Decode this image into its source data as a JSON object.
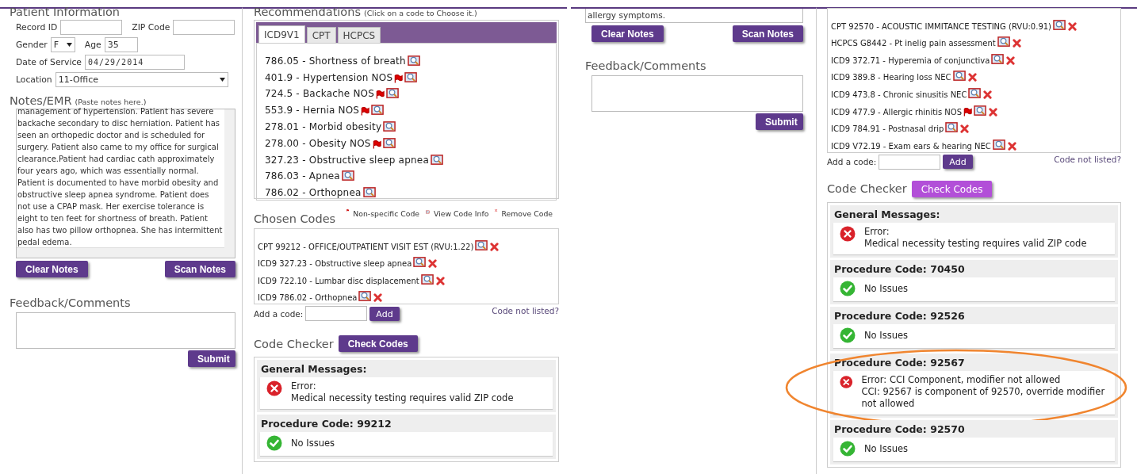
{
  "patient_form": {
    "title": "Patient Information",
    "rows": [
      [
        {
          "label": "Record ID",
          "kind": "text"
        },
        {
          "label": "ZIP Code",
          "kind": "text"
        }
      ],
      [
        {
          "label": "Gender",
          "kind": "select",
          "value": "F"
        },
        {
          "label": "Age",
          "kind": "text",
          "value": "35"
        }
      ],
      [
        {
          "label": "Date of Service",
          "kind": "date",
          "value": "04/29/2014"
        }
      ],
      [
        {
          "label": "Location",
          "kind": "select",
          "value": "11-Office"
        }
      ]
    ]
  },
  "notes": {
    "title": "Notes/EMR",
    "hint": "(Paste notes here.)",
    "text": "management of hypertension. Patient has severe backache secondary to disc herniation. Patient has seen an orthopedic doctor and is scheduled for surgery. Patient also came to my office for surgical clearance.Patient had cardiac cath approximately four years ago, which was essentially normal. Patient is documented to have morbid obesity and obstructive sleep apnea syndrome. Patient does not use a CPAP mask. Her exercise tolerance is eight to ten feet for shortness of breath. Patient also has two pillow orthopnea. She has intermittent pedal edema.",
    "buttons": [
      "Clear Notes",
      "Scan Notes"
    ]
  },
  "feedback": {
    "title": "Feedback/Comments",
    "button": "Submit"
  },
  "recommendations": {
    "title": "Recommendations",
    "hint": "(Click on a code to Choose it.)",
    "tabs": [
      {
        "label": "ICD9V1",
        "selected": true
      },
      {
        "label": "CPT",
        "selected": false
      },
      {
        "label": "HCPCS",
        "selected": false
      }
    ],
    "items": [
      {
        "text": "786.05 - Shortness of breath",
        "non_specific": false
      },
      {
        "text": "401.9 - Hypertension NOS",
        "non_specific": true
      },
      {
        "text": "724.5 - Backache NOS",
        "non_specific": true
      },
      {
        "text": "553.9 - Hernia NOS",
        "non_specific": true
      },
      {
        "text": "278.01 - Morbid obesity",
        "non_specific": false
      },
      {
        "text": "278.00 - Obesity NOS",
        "non_specific": true
      },
      {
        "text": "327.23 - Obstructive sleep apnea",
        "non_specific": false
      },
      {
        "text": "786.03 - Apnea",
        "non_specific": false
      },
      {
        "text": "786.02 - Orthopnea",
        "non_specific": false
      }
    ]
  },
  "chosen_codes": {
    "title": "Chosen Codes",
    "legend": [
      {
        "kind": "flag",
        "label": "Non-specific Code"
      },
      {
        "kind": "info",
        "label": "View Code Info"
      },
      {
        "kind": "remove",
        "label": "Remove Code"
      }
    ],
    "items": [
      {
        "text": "CPT 99212 - OFFICE/OUTPATIENT VISIT EST (RVU:1.22)",
        "non_specific": false
      },
      {
        "text": "ICD9 327.23 - Obstructive sleep apnea",
        "non_specific": false
      },
      {
        "text": "ICD9 722.10 - Lumbar disc displacement",
        "non_specific": false
      },
      {
        "text": "ICD9 786.02 - Orthopnea",
        "non_specific": false
      }
    ],
    "add_label": "Add a code:",
    "add_button": "Add",
    "link": "Code not listed?"
  },
  "code_checker": {
    "title": "Code Checker",
    "button": "Check Codes",
    "hovered": false,
    "groups": [
      {
        "heading": "General Messages:",
        "circled": false,
        "messages": [
          {
            "kind": "error",
            "lines": [
              "Error:",
              "Medical necessity testing requires valid ZIP code"
            ]
          }
        ]
      },
      {
        "heading": "Procedure Code: 99212",
        "circled": false,
        "messages": [
          {
            "kind": "ok",
            "lines": [
              "No Issues"
            ]
          }
        ]
      }
    ]
  },
  "notes_2": {
    "text": "allergy symptoms.",
    "buttons": [
      "Clear Notes",
      "Scan Notes"
    ]
  },
  "feedback_2": {
    "title": "Feedback/Comments",
    "button": "Submit"
  },
  "chosen_codes_2": {
    "items": [
      {
        "text": "CPT 92570 - ACOUSTIC IMMITANCE TESTING (RVU:0.91)",
        "non_specific": false
      },
      {
        "text": "HCPCS G8442 - Pt inelig pain assessment",
        "non_specific": false
      },
      {
        "text": "ICD9 372.71 - Hyperemia of conjunctiva",
        "non_specific": false
      },
      {
        "text": "ICD9 389.8 - Hearing loss NEC",
        "non_specific": false
      },
      {
        "text": "ICD9 473.8 - Chronic sinusitis NEC",
        "non_specific": false
      },
      {
        "text": "ICD9 477.9 - Allergic rhinitis NOS",
        "non_specific": true
      },
      {
        "text": "ICD9 784.91 - Postnasal drip",
        "non_specific": false
      },
      {
        "text": "ICD9 V72.19 - Exam ears & hearing NEC",
        "non_specific": false
      }
    ],
    "add_label": "Add a code:",
    "add_button": "Add",
    "link": "Code not listed?"
  },
  "code_checker_2": {
    "title": "Code Checker",
    "button": "Check Codes",
    "hovered": true,
    "groups": [
      {
        "heading": "General Messages:",
        "circled": false,
        "messages": [
          {
            "kind": "error",
            "lines": [
              "Error:",
              "Medical necessity testing requires valid ZIP code"
            ]
          }
        ]
      },
      {
        "heading": "Procedure Code: 70450",
        "circled": false,
        "messages": [
          {
            "kind": "ok",
            "lines": [
              "No Issues"
            ]
          }
        ]
      },
      {
        "heading": "Procedure Code: 92526",
        "circled": false,
        "messages": [
          {
            "kind": "ok",
            "lines": [
              "No Issues"
            ]
          }
        ]
      },
      {
        "heading": "Procedure Code: 92567",
        "circled": true,
        "messages": [
          {
            "kind": "error",
            "lines": [
              "Error: CCI Component, modifier not allowed",
              "CCI: 92567 is component of 92570, override modifier not allowed"
            ]
          }
        ]
      },
      {
        "heading": "Procedure Code: 92570",
        "circled": false,
        "messages": [
          {
            "kind": "ok",
            "lines": [
              "No Issues"
            ]
          }
        ]
      }
    ]
  }
}
